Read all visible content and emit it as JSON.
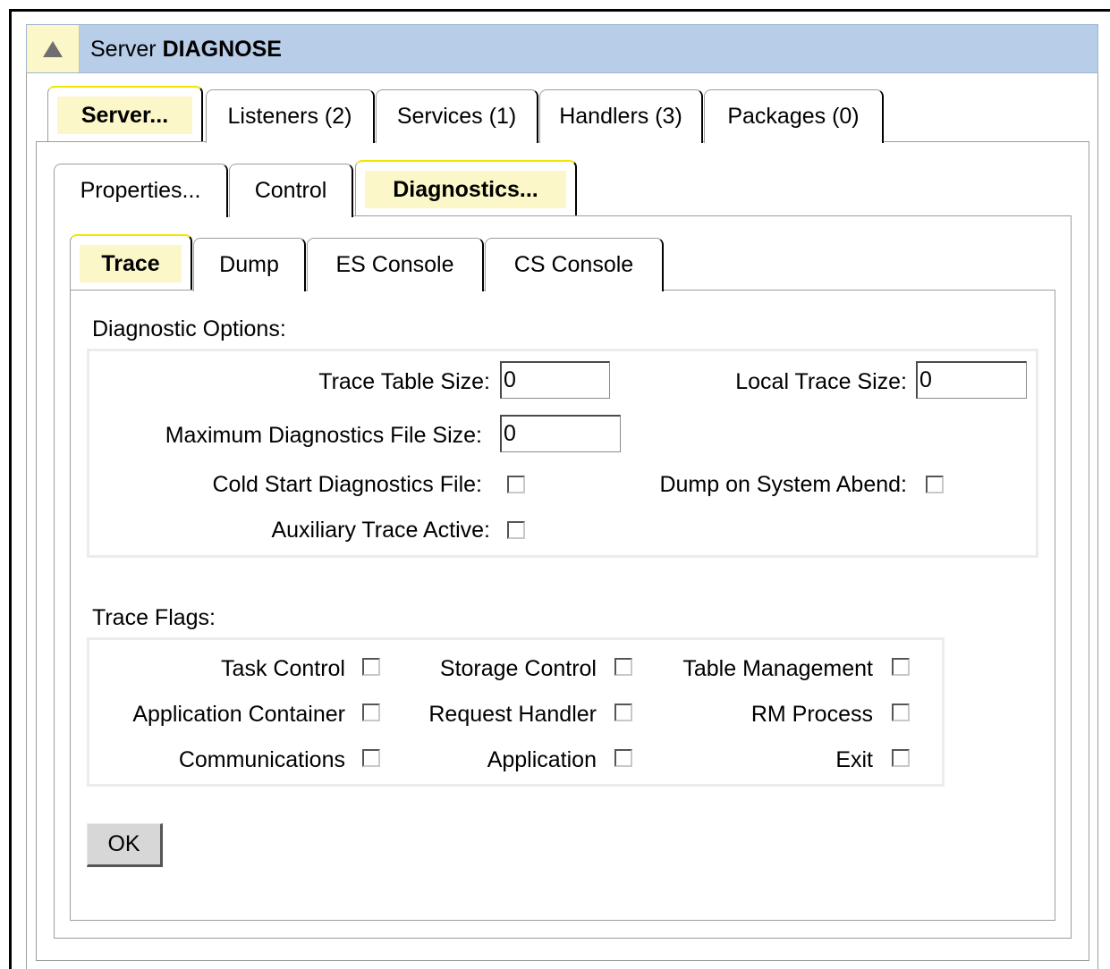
{
  "window": {
    "title_prefix": "Server",
    "title_name": "DIAGNOSE",
    "collapse_icon": "triangle-up-icon"
  },
  "main_tabs": [
    {
      "label": "Server...",
      "active": true
    },
    {
      "label": "Listeners (2)",
      "active": false
    },
    {
      "label": "Services (1)",
      "active": false
    },
    {
      "label": "Handlers (3)",
      "active": false
    },
    {
      "label": "Packages (0)",
      "active": false
    }
  ],
  "server_tabs": [
    {
      "label": "Properties...",
      "active": false
    },
    {
      "label": "Control",
      "active": false
    },
    {
      "label": "Diagnostics...",
      "active": true
    }
  ],
  "diag_tabs": [
    {
      "label": "Trace",
      "active": true
    },
    {
      "label": "Dump",
      "active": false
    },
    {
      "label": "ES Console",
      "active": false
    },
    {
      "label": "CS Console",
      "active": false
    }
  ],
  "diagnostic_options": {
    "heading": "Diagnostic Options:",
    "trace_table_size_label": "Trace Table Size:",
    "trace_table_size_value": "0",
    "local_trace_size_label": "Local Trace Size:",
    "local_trace_size_value": "0",
    "max_file_size_label": "Maximum Diagnostics File Size:",
    "max_file_size_value": "0",
    "cold_start_label": "Cold Start Diagnostics File:",
    "cold_start_checked": false,
    "dump_abend_label": "Dump on System Abend:",
    "dump_abend_checked": false,
    "aux_trace_label": "Auxiliary Trace Active:",
    "aux_trace_checked": false
  },
  "trace_flags": {
    "heading": "Trace Flags:",
    "items": [
      {
        "label": "Task Control",
        "checked": false
      },
      {
        "label": "Storage Control",
        "checked": false
      },
      {
        "label": "Table Management",
        "checked": false
      },
      {
        "label": "Application Container",
        "checked": false
      },
      {
        "label": "Request Handler",
        "checked": false
      },
      {
        "label": "RM Process",
        "checked": false
      },
      {
        "label": "Communications",
        "checked": false
      },
      {
        "label": "Application",
        "checked": false
      },
      {
        "label": "Exit",
        "checked": false
      }
    ]
  },
  "ok_button": {
    "label": "OK"
  }
}
